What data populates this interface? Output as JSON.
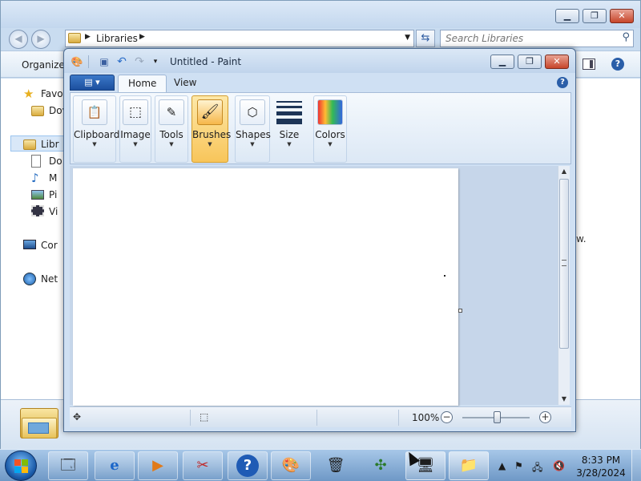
{
  "explorer": {
    "breadcrumb": "Libraries",
    "search_placeholder": "Search Libraries",
    "toolbar": {
      "organize": "Organize"
    },
    "nav_items": [
      {
        "label": "Favor",
        "icon": "star-icon"
      },
      {
        "label": "Dov",
        "icon": "folder-icon"
      },
      {
        "label": "Libr",
        "icon": "library-icon"
      },
      {
        "label": "Do",
        "icon": "document-icon"
      },
      {
        "label": "M",
        "icon": "music-icon"
      },
      {
        "label": "Pi",
        "icon": "picture-icon"
      },
      {
        "label": "Vi",
        "icon": "video-icon"
      },
      {
        "label": "Cor",
        "icon": "computer-icon"
      },
      {
        "label": "Net",
        "icon": "network-icon"
      }
    ],
    "side_text": "w."
  },
  "paint": {
    "title": "Untitled - Paint",
    "tabs": [
      {
        "label": "Home",
        "active": true
      },
      {
        "label": "View",
        "active": false
      }
    ],
    "ribbon_groups": [
      {
        "label": "Clipboard",
        "icon": "clipboard-icon"
      },
      {
        "label": "Image",
        "icon": "select-icon"
      },
      {
        "label": "Tools",
        "icon": "tools-icon"
      },
      {
        "label": "Brushes",
        "icon": "brush-icon",
        "highlighted": true
      },
      {
        "label": "Shapes",
        "icon": "shapes-icon"
      },
      {
        "label": "Size",
        "icon": "line-size-icon"
      },
      {
        "label": "Colors",
        "icon": "colors-icon"
      }
    ],
    "status": {
      "zoom": "100%",
      "zoom_level": 1.0
    }
  },
  "taskbar": {
    "items": [
      {
        "name": "server-manager",
        "icon": "server-manager-icon"
      },
      {
        "name": "internet-explorer",
        "icon": "internet-explorer-icon"
      },
      {
        "name": "media-player",
        "icon": "media-player-icon"
      },
      {
        "name": "snipping-tool",
        "icon": "snipping-tool-icon"
      },
      {
        "name": "help",
        "icon": "help-icon"
      },
      {
        "name": "paint",
        "icon": "paint-icon"
      },
      {
        "name": "recycle",
        "icon": "recycle-icon"
      },
      {
        "name": "network",
        "icon": "network-app-icon"
      },
      {
        "name": "monitor",
        "icon": "monitor-icon"
      },
      {
        "name": "explorer",
        "icon": "explorer-icon"
      }
    ],
    "clock": {
      "time": "8:33 PM",
      "date": "3/28/2024"
    }
  }
}
